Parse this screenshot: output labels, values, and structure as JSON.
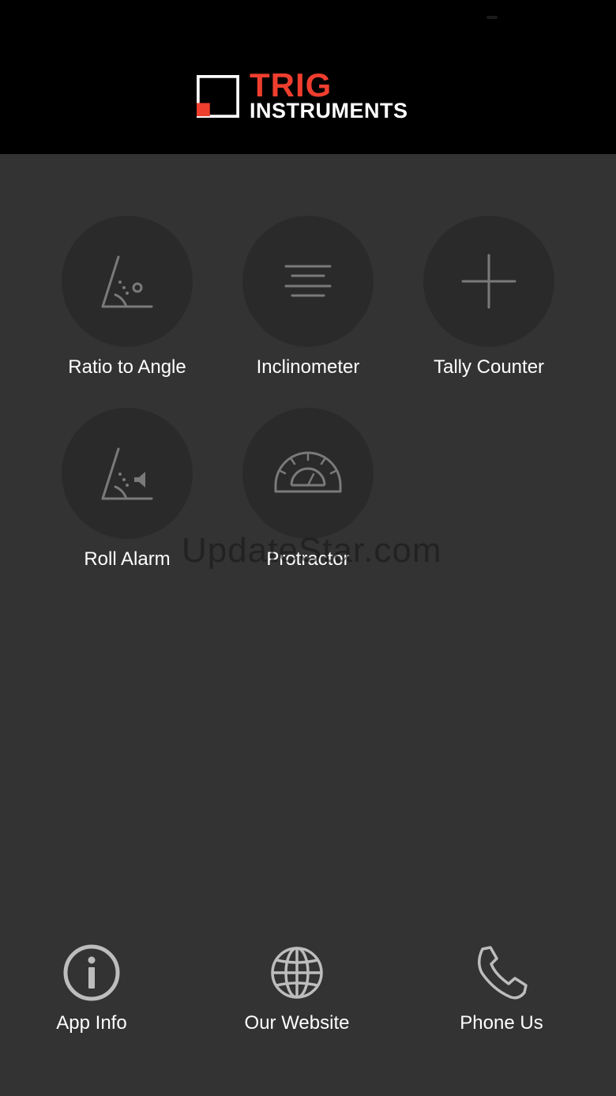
{
  "brand": {
    "line1": "TRIG",
    "line2": "INSTRUMENTS",
    "accent_color": "#ef3e2e"
  },
  "tools": [
    {
      "label": "Ratio to Angle",
      "icon": "ratio-angle-icon"
    },
    {
      "label": "Inclinometer",
      "icon": "level-lines-icon"
    },
    {
      "label": "Tally Counter",
      "icon": "plus-icon"
    },
    {
      "label": "Roll Alarm",
      "icon": "roll-alarm-icon"
    },
    {
      "label": "Protractor",
      "icon": "protractor-icon"
    }
  ],
  "watermark": "UpdateStar.com",
  "bottom_nav": [
    {
      "label": "App Info",
      "icon": "info-icon"
    },
    {
      "label": "Our Website",
      "icon": "globe-icon"
    },
    {
      "label": "Phone Us",
      "icon": "phone-icon"
    }
  ]
}
